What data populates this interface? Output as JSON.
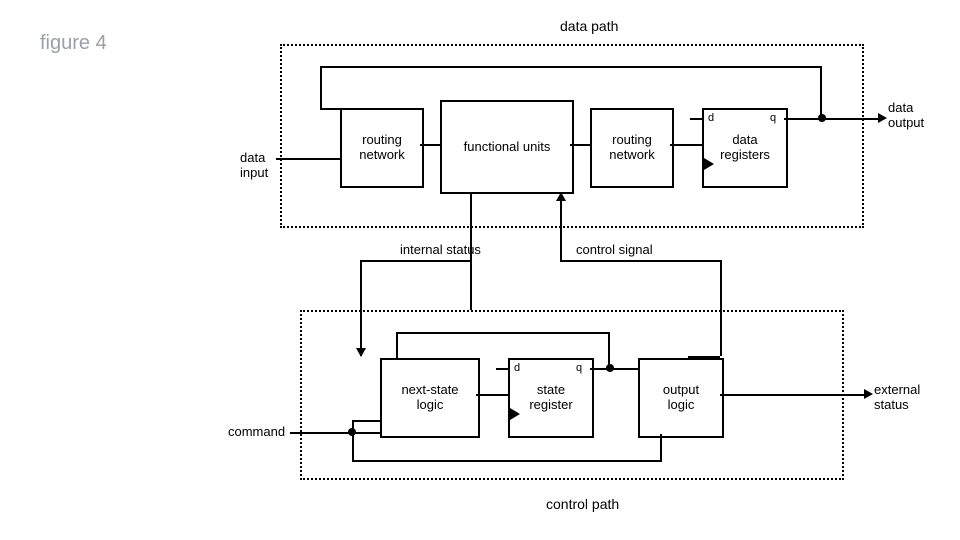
{
  "figure_caption": "figure 4",
  "datapath": {
    "title": "data path",
    "blocks": {
      "routing_network_in": "routing\nnetwork",
      "functional_units": "functional units",
      "routing_network_out": "routing\nnetwork",
      "data_registers": "data\nregisters"
    },
    "ports": {
      "d": "d",
      "q": "q"
    },
    "io": {
      "data_input": "data\ninput",
      "data_output": "data\noutput"
    }
  },
  "signals": {
    "internal_status": "internal status",
    "control_signal": "control signal"
  },
  "controlpath": {
    "title": "control path",
    "blocks": {
      "next_state_logic": "next-state\nlogic",
      "state_register": "state\nregister",
      "output_logic": "output\nlogic"
    },
    "ports": {
      "d": "d",
      "q": "q"
    },
    "io": {
      "command": "command",
      "external_status": "external\nstatus"
    }
  }
}
